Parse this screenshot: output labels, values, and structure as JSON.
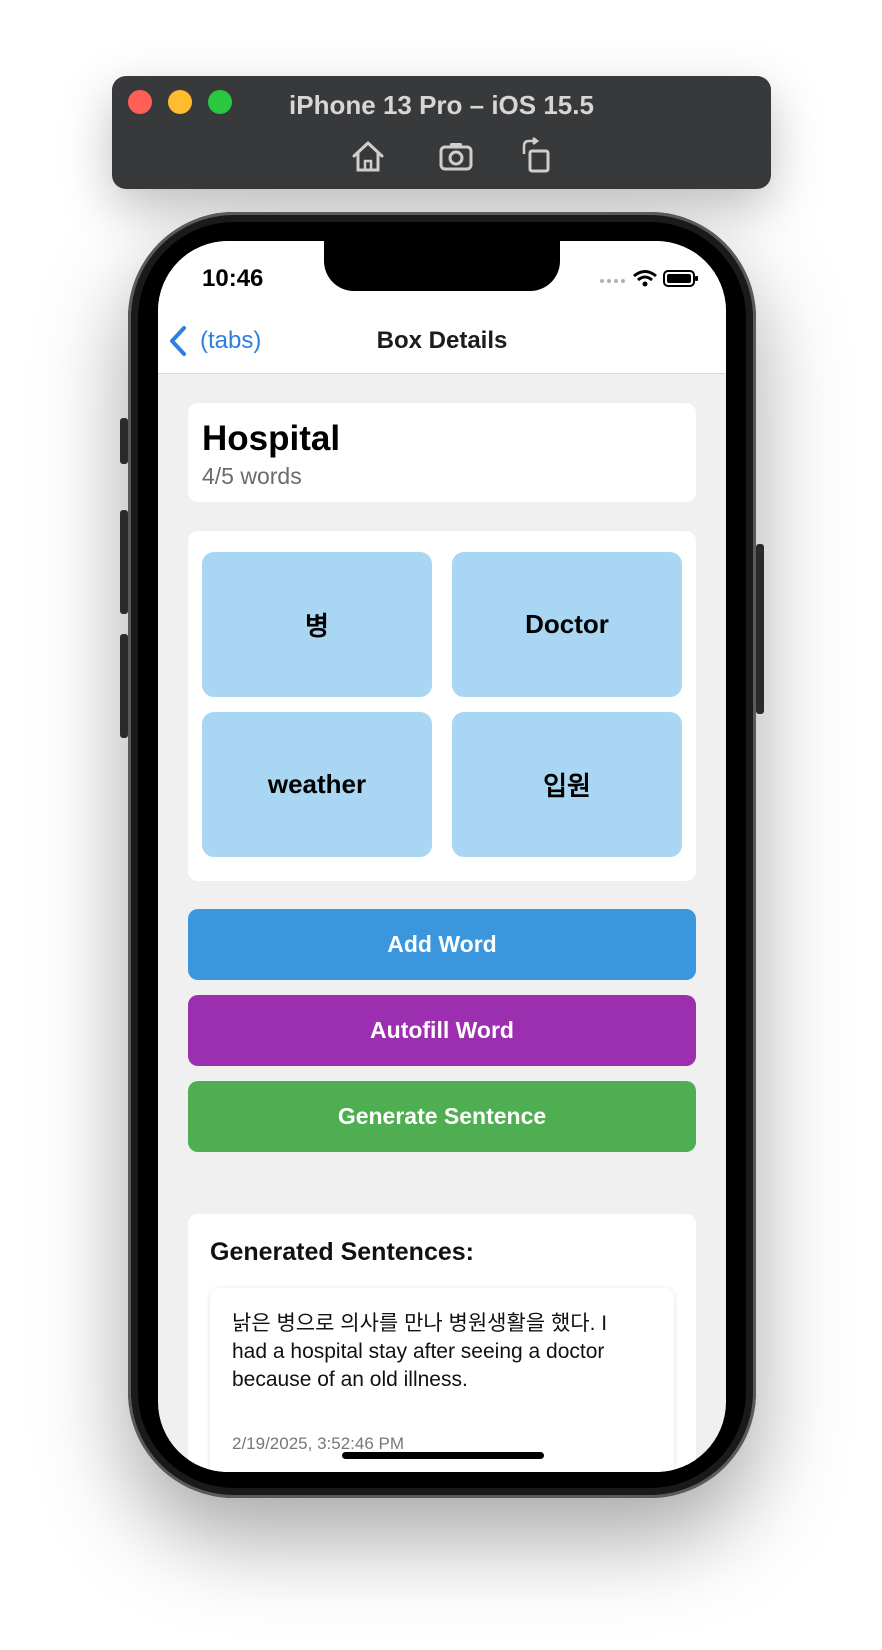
{
  "simulator": {
    "title": "iPhone 13 Pro – iOS 15.5",
    "tools": [
      "home-icon",
      "screenshot-icon",
      "rotate-icon"
    ]
  },
  "status_bar": {
    "time": "10:46",
    "icons": [
      "signal-icon",
      "wifi-icon",
      "battery-icon"
    ]
  },
  "navbar": {
    "back_label": "(tabs)",
    "title": "Box Details"
  },
  "box": {
    "name": "Hospital",
    "count": "4/5 words"
  },
  "words": [
    {
      "label": "병"
    },
    {
      "label": "Doctor"
    },
    {
      "label": "weather"
    },
    {
      "label": "입원"
    }
  ],
  "actions": {
    "add_word": "Add Word",
    "autofill_word": "Autofill Word",
    "generate_sentence": "Generate Sentence"
  },
  "colors": {
    "accent": "#2f7fe0",
    "tile": "#a9d6f2",
    "add_word": "#3a97dd",
    "autofill_word": "#9c2eb0",
    "generate_sentence": "#4fae52"
  },
  "generated": {
    "title": "Generated Sentences:",
    "items": [
      {
        "text": "낡은 병으로 의사를 만나 병원생활을 했다.  I had a hospital stay after seeing a doctor because of an old illness.",
        "timestamp": "2/19/2025, 3:52:46 PM"
      }
    ]
  }
}
